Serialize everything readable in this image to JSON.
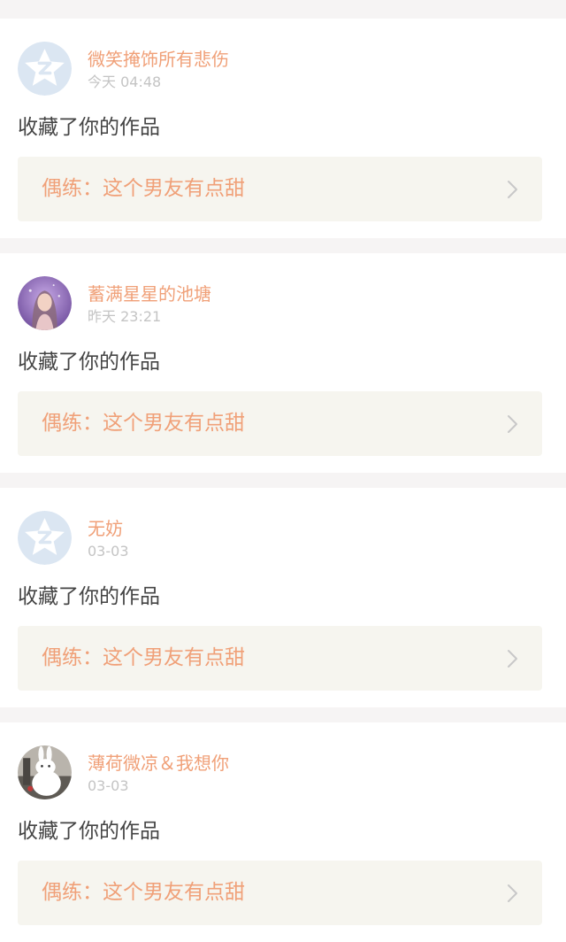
{
  "feed": {
    "items": [
      {
        "username": "微笑掩饰所有悲伤",
        "time": "今天 04:48",
        "action": "收藏了你的作品",
        "work_title": "偶练：这个男友有点甜",
        "avatar": "default-star-avatar"
      },
      {
        "username": "蓄满星星的池塘",
        "time": "昨天 23:21",
        "action": "收藏了你的作品",
        "work_title": "偶练：这个男友有点甜",
        "avatar": "purple-photo-avatar"
      },
      {
        "username": "无妨",
        "time": "03-03",
        "action": "收藏了你的作品",
        "work_title": "偶练：这个男友有点甜",
        "avatar": "default-star-avatar"
      },
      {
        "username": "薄荷微凉＆我想你",
        "time": "03-03",
        "action": "收藏了你的作品",
        "work_title": "偶练：这个男友有点甜",
        "avatar": "white-rabbit-photo-avatar"
      }
    ]
  },
  "colors": {
    "accent": "#f0a078",
    "muted": "#c4c4c4",
    "body_text": "#444444",
    "link_bg": "#f6f5ef",
    "page_bg": "#f6f4f4",
    "default_avatar_bg": "#dbe6f2"
  }
}
